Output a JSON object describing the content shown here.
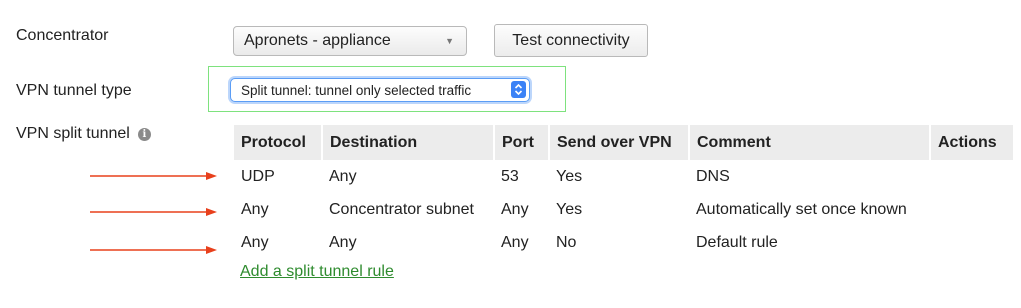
{
  "concentrator": {
    "label": "Concentrator",
    "selected": "Apronets - appliance",
    "test_button": "Test connectivity"
  },
  "vpn_tunnel_type": {
    "label": "VPN tunnel type",
    "selected": "Split tunnel: tunnel only selected traffic"
  },
  "split_tunnel": {
    "label": "VPN split tunnel",
    "columns": [
      "Protocol",
      "Destination",
      "Port",
      "Send over VPN",
      "Comment",
      "Actions"
    ],
    "rows": [
      {
        "protocol": "UDP",
        "destination": "Any",
        "port": "53",
        "send_over_vpn": "Yes",
        "comment": "DNS",
        "actions": ""
      },
      {
        "protocol": "Any",
        "destination": "Concentrator subnet",
        "port": "Any",
        "send_over_vpn": "Yes",
        "comment": "Automatically set once known",
        "actions": ""
      },
      {
        "protocol": "Any",
        "destination": "Any",
        "port": "Any",
        "send_over_vpn": "No",
        "comment": "Default rule",
        "actions": ""
      }
    ],
    "add_link": "Add a split tunnel rule"
  },
  "colors": {
    "annotation_arrow": "#e8401c",
    "highlight_box": "#7ee27e",
    "link": "#2e8b2e",
    "select_focus": "#3b82f6"
  },
  "icons": {
    "info": "info-icon",
    "dropdown_caret": "caret-down-icon",
    "select_stepper": "up-down-stepper-icon"
  }
}
